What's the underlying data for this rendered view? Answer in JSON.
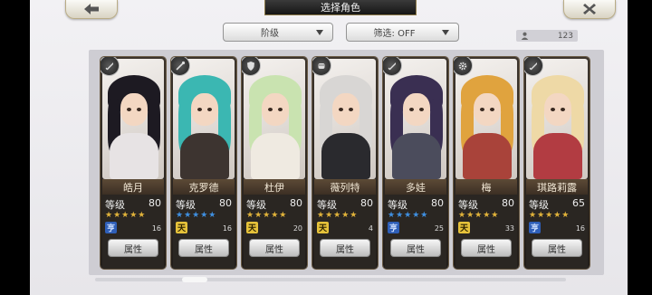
{
  "header": {
    "title": "选择角色",
    "back_icon": "back-arrow-icon",
    "close_icon": "close-icon"
  },
  "filters": {
    "sort_label": "阶级",
    "filter_label": "筛选: OFF"
  },
  "counter": {
    "icon": "person-icon",
    "value": "123"
  },
  "colors": {
    "frame_bg": "#ebeaee",
    "panel_bg": "#cecdd3",
    "card_bg": "#2a2622",
    "gold_star": "#e0b23a",
    "blue_star": "#3f8fe0"
  },
  "labels": {
    "level": "等级",
    "attr": "属性"
  },
  "characters": [
    {
      "name": "皓月",
      "level": "80",
      "stars": "★★★★★",
      "star_color": "gold",
      "rank": "亨",
      "rank_color": "blue",
      "count": "16",
      "class_icon": "sword-icon",
      "hair": "#1d1a22",
      "outfit": "#e7e3e4"
    },
    {
      "name": "克罗德",
      "level": "80",
      "stars": "★★★★★",
      "star_color": "blue",
      "rank": "天",
      "rank_color": "gold",
      "count": "16",
      "class_icon": "staff-icon",
      "hair": "#3bb7b2",
      "outfit": "#3d3430"
    },
    {
      "name": "杜伊",
      "level": "80",
      "stars": "★★★★★",
      "star_color": "gold",
      "rank": "天",
      "rank_color": "gold",
      "count": "20",
      "class_icon": "shield-icon",
      "hair": "#c9e3b0",
      "outfit": "#efeae1"
    },
    {
      "name": "薇列特",
      "level": "80",
      "stars": "★★★★★",
      "star_color": "gold",
      "rank": "天",
      "rank_color": "gold",
      "count": "4",
      "class_icon": "fist-icon",
      "hair": "#d8d6d4",
      "outfit": "#2a2a2e"
    },
    {
      "name": "多娃",
      "level": "80",
      "stars": "★★★★★",
      "star_color": "blue",
      "rank": "亨",
      "rank_color": "blue",
      "count": "25",
      "class_icon": "sword-icon",
      "hair": "#3a2f52",
      "outfit": "#4b4c5c"
    },
    {
      "name": "梅",
      "level": "80",
      "stars": "★★★★★",
      "star_color": "gold",
      "rank": "天",
      "rank_color": "gold",
      "count": "33",
      "class_icon": "gear-icon",
      "hair": "#e0a33e",
      "outfit": "#a9433a"
    },
    {
      "name": "琪路莉露",
      "level": "65",
      "stars": "★★★★★",
      "star_color": "gold",
      "rank": "亨",
      "rank_color": "blue",
      "count": "16",
      "class_icon": "sword-icon",
      "hair": "#eed9a6",
      "outfit": "#b23c42"
    }
  ]
}
